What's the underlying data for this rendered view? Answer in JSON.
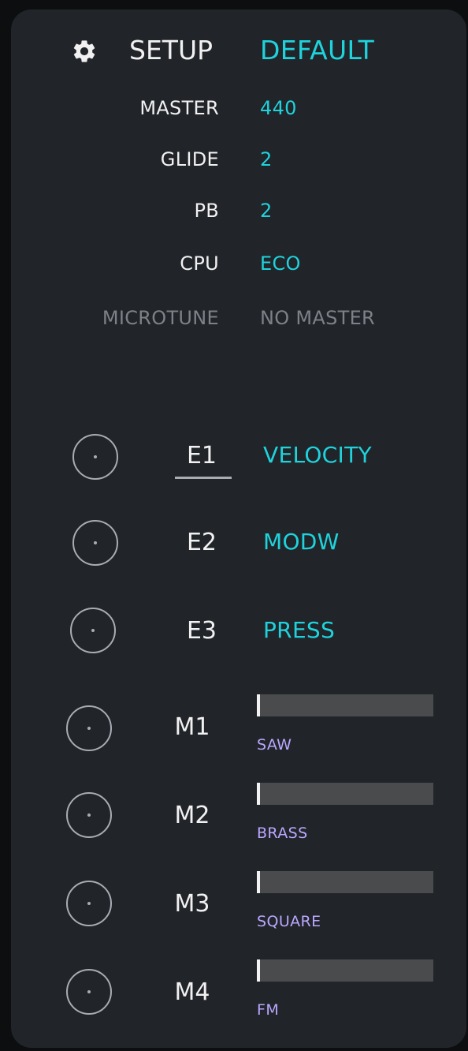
{
  "setup": {
    "title": "SETUP",
    "preset": "DEFAULT",
    "rows": [
      {
        "label": "MASTER",
        "value": "440",
        "enabled": true
      },
      {
        "label": "GLIDE",
        "value": "2",
        "enabled": true
      },
      {
        "label": "PB",
        "value": "2",
        "enabled": true
      },
      {
        "label": "CPU",
        "value": "ECO",
        "enabled": true
      },
      {
        "label": "MICROTUNE",
        "value": "NO MASTER",
        "enabled": false
      }
    ]
  },
  "expressions": [
    {
      "label": "E1",
      "target": "VELOCITY",
      "selected": true
    },
    {
      "label": "E2",
      "target": "MODW",
      "selected": false
    },
    {
      "label": "E3",
      "target": "PRESS",
      "selected": false
    }
  ],
  "macros": [
    {
      "label": "M1",
      "caption": "SAW",
      "level": 0.02
    },
    {
      "label": "M2",
      "caption": "BRASS",
      "level": 0.02
    },
    {
      "label": "M3",
      "caption": "SQUARE",
      "level": 0.02
    },
    {
      "label": "M4",
      "caption": "FM",
      "level": 0.02
    }
  ],
  "colors": {
    "accent": "#1fd3dc",
    "macro_caption": "#b9a7ff",
    "disabled": "#7d8188",
    "panel": "#212429"
  },
  "icons": {
    "settings": "gear-icon",
    "knob": "knob-icon"
  }
}
